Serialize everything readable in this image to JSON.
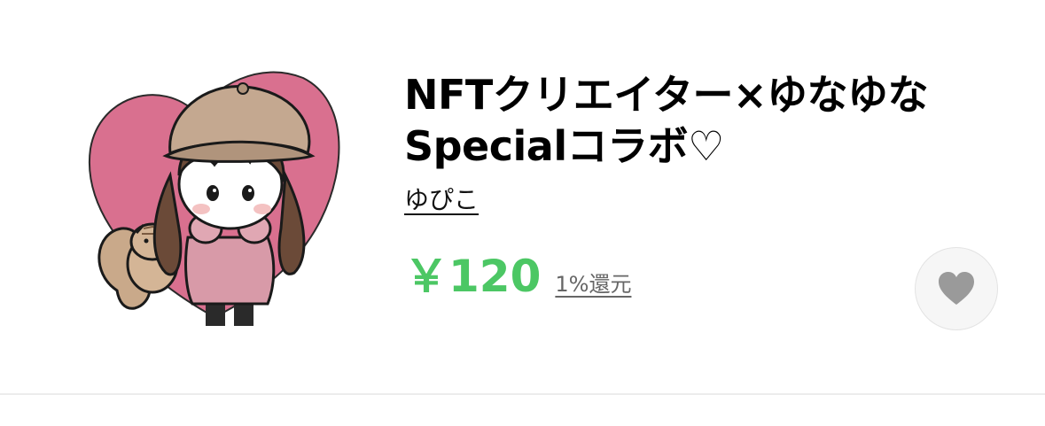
{
  "sticker": {
    "thumbnail_icon": "girl-with-squirrel-sticker-image",
    "title_line1": "NFTクリエイター×ゆなゆな",
    "title_line2": "Specialコラボ♡",
    "author": "ゆぴこ",
    "price": "￥120",
    "points_label": "1%還元"
  },
  "favorite": {
    "icon": "heart-icon"
  },
  "colors": {
    "price_green": "#4cc764",
    "heart_gray": "#9a9a9a",
    "thumbnail_heart_pink": "#d9708f"
  }
}
